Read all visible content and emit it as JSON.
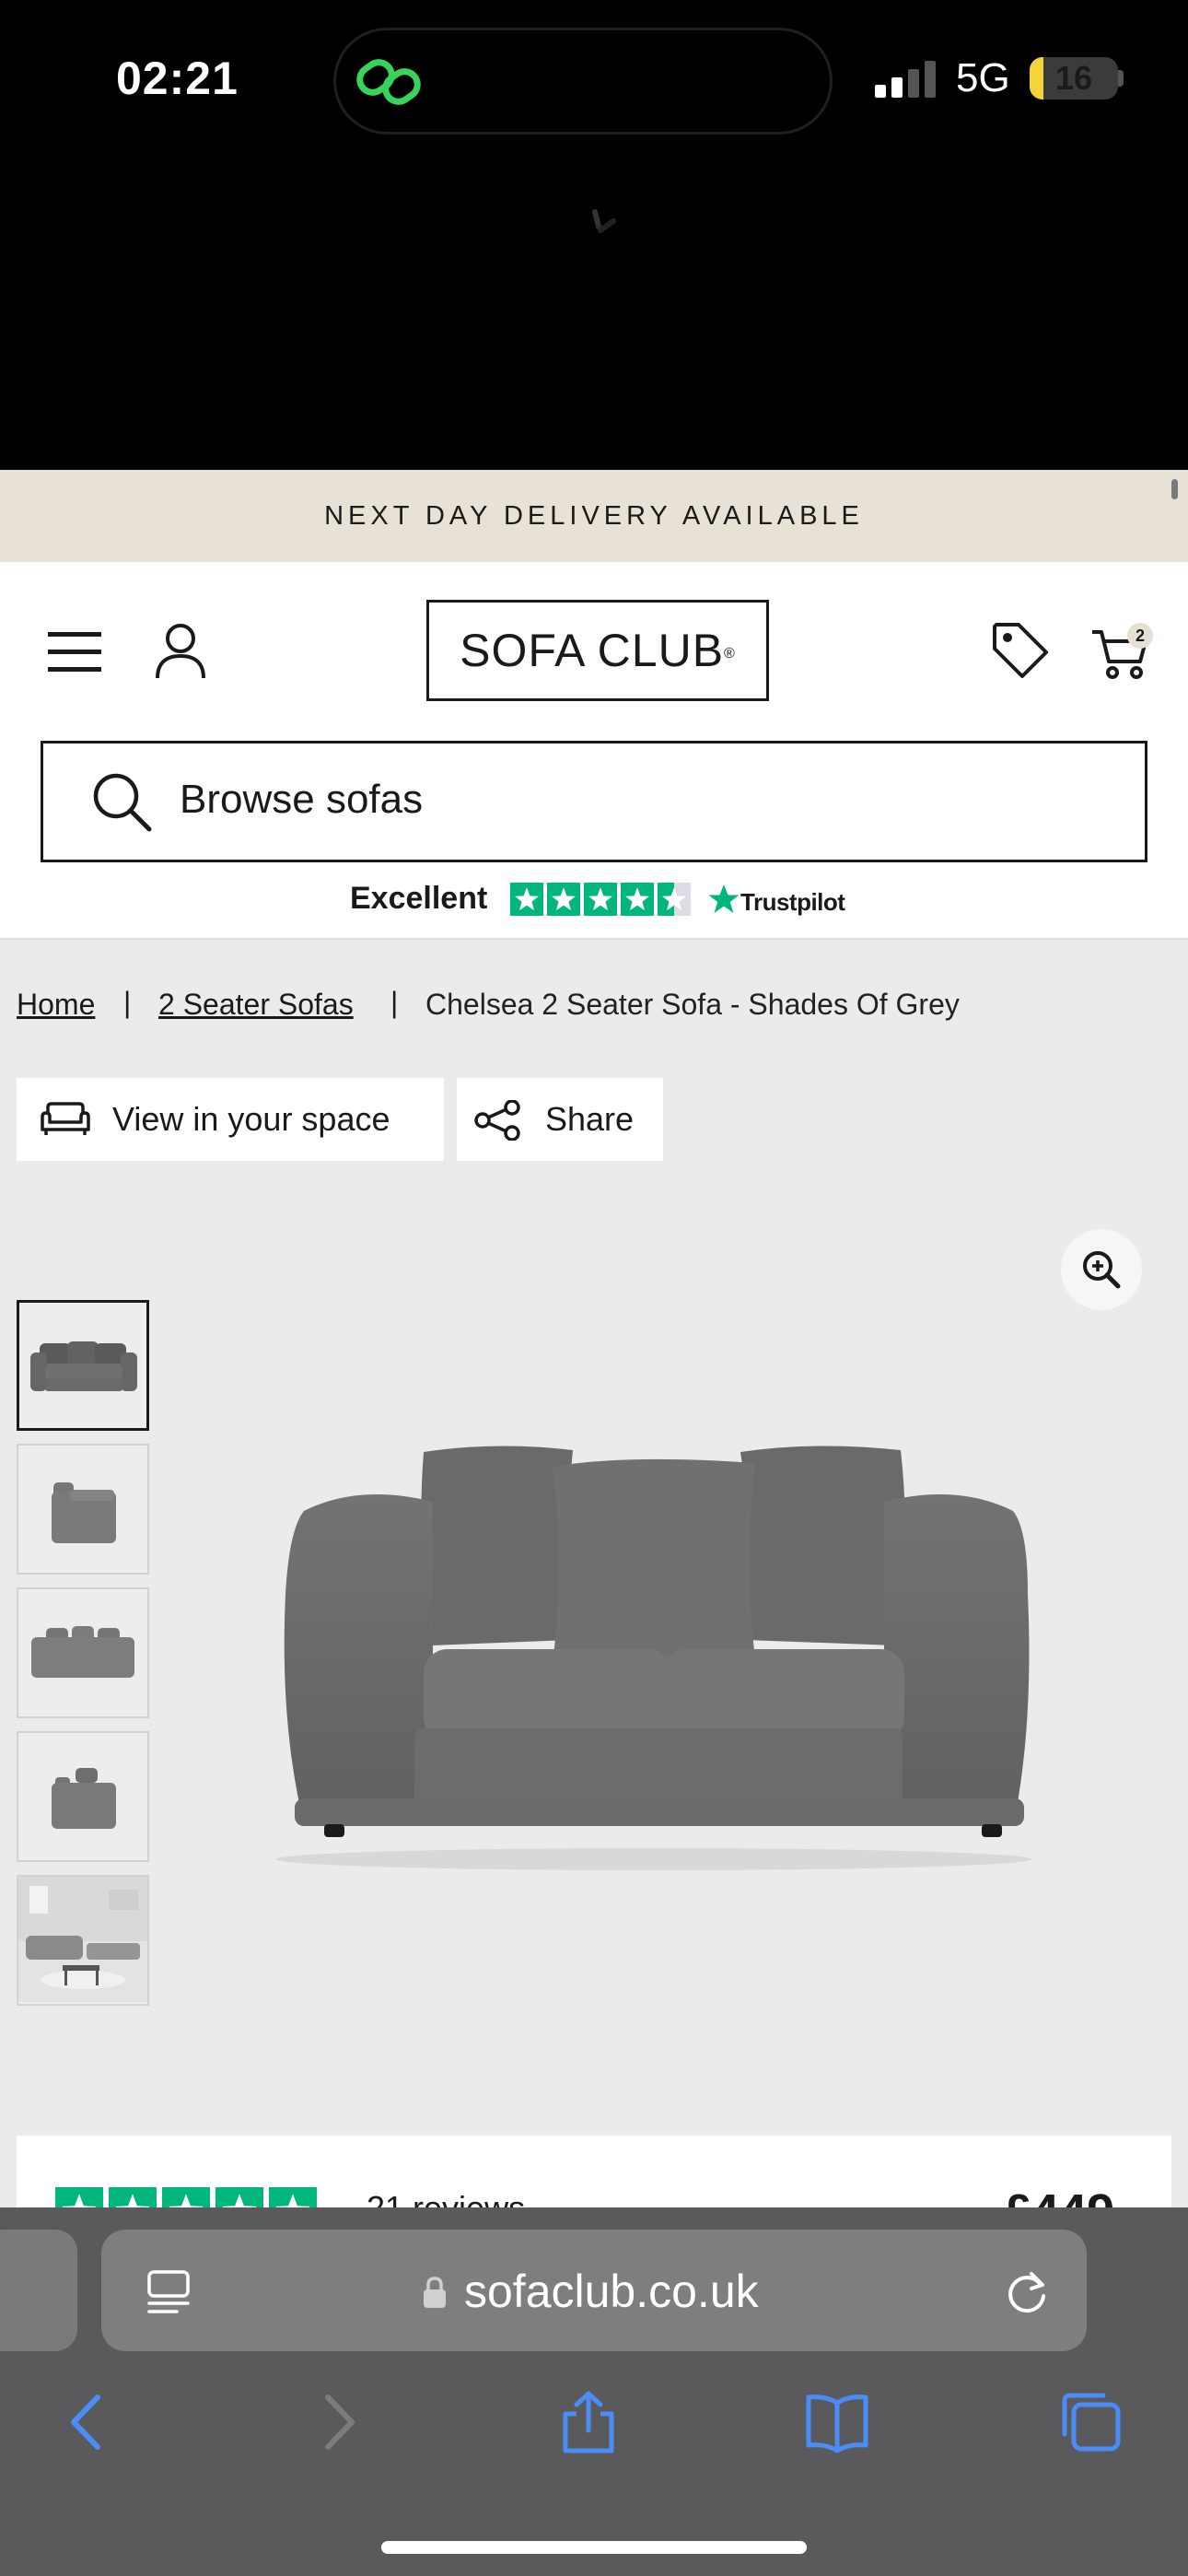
{
  "status": {
    "time": "02:21",
    "network": "5G",
    "battery": "16",
    "battery_fraction": 0.16
  },
  "announcement": "NEXT DAY DELIVERY AVAILABLE",
  "header": {
    "logo": "SOFA CLUB",
    "logo_mark": "®",
    "cart_count": "2"
  },
  "search": {
    "placeholder": "Browse sofas"
  },
  "trustpilot": {
    "rating_label": "Excellent",
    "brand": "Trustpilot",
    "stars": 4.5
  },
  "breadcrumb": {
    "home": "Home",
    "category": "2 Seater Sofas",
    "current": "Chelsea 2 Seater Sofa - Shades Of Grey",
    "separator": "|"
  },
  "actions": {
    "view_in_space": "View in your space",
    "share": "Share"
  },
  "gallery": {
    "thumbnails": [
      "front",
      "side",
      "back",
      "angle",
      "room"
    ],
    "active_index": 0
  },
  "review": {
    "count_text": "21 reviews",
    "price_text": "£449",
    "stars": 5
  },
  "browser": {
    "url": "sofaclub.co.uk"
  },
  "colors": {
    "accent_green": "#00b67a",
    "banner_bg": "#e8e1d6",
    "sofa_grey": "#6b6b6b"
  }
}
